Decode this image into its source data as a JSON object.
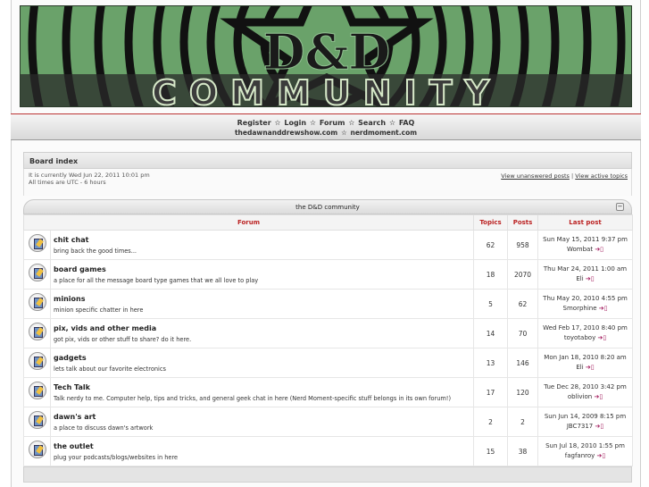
{
  "banner": {
    "line1": "D&D",
    "line2": "COMMUNITY"
  },
  "nav": {
    "links": [
      "Register",
      "Login",
      "Forum",
      "Search",
      "FAQ"
    ],
    "sites": [
      "thedawnanddrewshow.com",
      "nerdmoment.com"
    ],
    "separator": "✫"
  },
  "breadcrumb": "Board index",
  "info": {
    "current_time": "It is currently Wed Jun 22, 2011 10:01 pm",
    "timezone": "All times are UTC - 6 hours",
    "unanswered": "View unanswered posts",
    "divider": "|",
    "active": "View active topics"
  },
  "category": {
    "title": "the D&D community",
    "collapse": "−"
  },
  "columns": {
    "forum": "Forum",
    "topics": "Topics",
    "posts": "Posts",
    "last": "Last post"
  },
  "forums": [
    {
      "name": "chit chat",
      "desc": "bring back the good times...",
      "topics": "62",
      "posts": "958",
      "last_date": "Sun May 15, 2011 9:37 pm",
      "last_by": "Wombat"
    },
    {
      "name": "board games",
      "desc": "a place for all the message board type games that we all love to play",
      "topics": "18",
      "posts": "2070",
      "last_date": "Thu Mar 24, 2011 1:00 am",
      "last_by": "Eli"
    },
    {
      "name": "minions",
      "desc": "minion specific chatter in here",
      "topics": "5",
      "posts": "62",
      "last_date": "Thu May 20, 2010 4:55 pm",
      "last_by": "Smorphine"
    },
    {
      "name": "pix, vids and other media",
      "desc": "got pix, vids or other stuff to share? do it here.",
      "topics": "14",
      "posts": "70",
      "last_date": "Wed Feb 17, 2010 8:40 pm",
      "last_by": "toyotaboy"
    },
    {
      "name": "gadgets",
      "desc": "lets talk about our favorite electronics",
      "topics": "13",
      "posts": "146",
      "last_date": "Mon Jan 18, 2010 8:20 am",
      "last_by": "Eli"
    },
    {
      "name": "Tech Talk",
      "desc": "Talk nerdy to me. Computer help, tips and tricks, and general geek chat in here (Nerd Moment-specific stuff belongs in its own forum!)",
      "topics": "17",
      "posts": "120",
      "last_date": "Tue Dec 28, 2010 3:42 pm",
      "last_by": "oblivion"
    },
    {
      "name": "dawn's art",
      "desc": "a place to discuss dawn's artwork",
      "topics": "2",
      "posts": "2",
      "last_date": "Sun Jun 14, 2009 8:15 pm",
      "last_by": "JBC7317"
    },
    {
      "name": "the outlet",
      "desc": "plug your podcasts/blogs/websites in here",
      "topics": "15",
      "posts": "38",
      "last_date": "Sun Jul 18, 2010 1:55 pm",
      "last_by": "fagfanroy"
    }
  ],
  "colors": {
    "banner_green": "#6aa26a",
    "header_red": "#b22222",
    "link_arrow": "#a0165a"
  }
}
